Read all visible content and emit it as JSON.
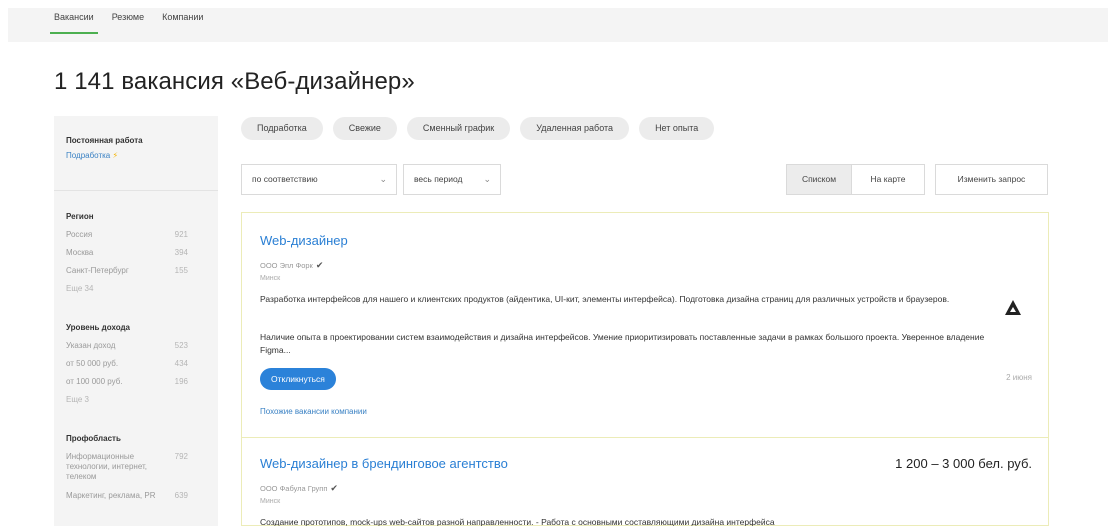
{
  "nav": {
    "tabs": [
      {
        "label": "Вакансии",
        "active": true
      },
      {
        "label": "Резюме",
        "active": false
      },
      {
        "label": "Компании",
        "active": false
      }
    ]
  },
  "page": {
    "title": "1 141 вакансия «Веб-дизайнер»"
  },
  "sidebar": {
    "employment": {
      "heading": "Постоянная работа",
      "link": "Подработка",
      "link_icon": "bolt-icon"
    },
    "region": {
      "heading": "Регион",
      "items": [
        {
          "label": "Россия",
          "count": "921"
        },
        {
          "label": "Москва",
          "count": "394"
        },
        {
          "label": "Санкт-Петербург",
          "count": "155"
        }
      ],
      "more": "Еще 34"
    },
    "income": {
      "heading": "Уровень дохода",
      "items": [
        {
          "label": "Указан доход",
          "count": "523"
        },
        {
          "label": "от 50 000 руб.",
          "count": "434"
        },
        {
          "label": "от 100 000 руб.",
          "count": "196"
        }
      ],
      "more": "Еще 3"
    },
    "area": {
      "heading": "Профобласть",
      "items": [
        {
          "label": "Информационные технологии, интернет, телеком",
          "count": "792"
        },
        {
          "label": "Маркетинг, реклама, PR",
          "count": "639"
        }
      ]
    }
  },
  "chips": [
    "Подработка",
    "Свежие",
    "Сменный график",
    "Удаленная работа",
    "Нет опыта"
  ],
  "filters": {
    "sort": "по соответствию",
    "period": "весь период"
  },
  "view": {
    "list": "Списком",
    "map": "На карте",
    "change": "Изменить запрос"
  },
  "vacancies": [
    {
      "title": "Web-дизайнер",
      "company": "ООО Эпл Форк",
      "city": "Минск",
      "description": "Разработка интерфейсов для нашего и клиентских продуктов (айдентика, UI-кит, элементы интерфейса). Подготовка дизайна страниц для различных устройств и браузеров.",
      "requirements": "Наличие опыта в проектировании систем взаимодействия и дизайна интерфейсов. Умение приоритизировать поставленные задачи в рамках большого проекта. Уверенное владение Figma...",
      "respond": "Откликнуться",
      "date": "2 июня",
      "similar": "Похожие вакансии компании"
    },
    {
      "title": "Web-дизайнер в брендинговое агентство",
      "company": "ООО Фабула Групп",
      "city": "Минск",
      "salary": "1 200 – 3 000 бел. руб.",
      "description": "Создание прототипов, mock-ups web-сайтов разной направленности. - Работа с основными составляющими дизайна интерфейса"
    }
  ],
  "colors": {
    "accent_green": "#4caf50",
    "link_blue": "#2a7fd4",
    "button_blue": "#2b82d9",
    "chip_bg": "#ececec"
  }
}
